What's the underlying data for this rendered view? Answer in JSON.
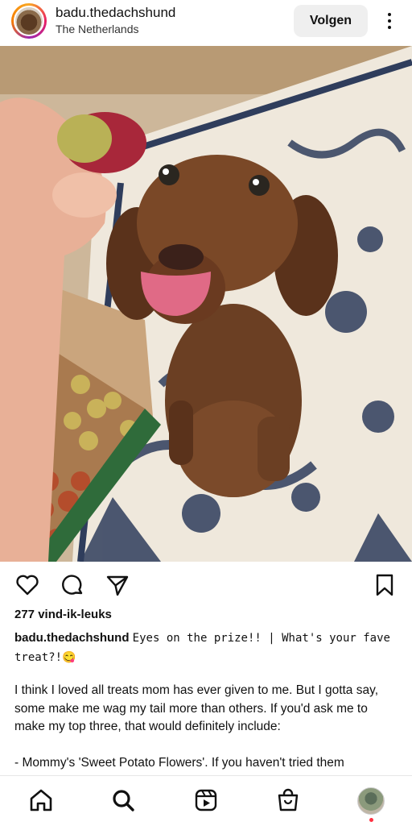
{
  "post_header": {
    "username": "badu.thedachshund",
    "location": "The Netherlands",
    "follow_label": "Volgen"
  },
  "photo": {
    "icon": "post-photo-dachshund"
  },
  "actions": {
    "like_icon": "heart-icon",
    "comment_icon": "comment-icon",
    "share_icon": "send-icon",
    "save_icon": "bookmark-icon"
  },
  "likes_text": "277 vind-ik-leuks",
  "caption": {
    "username": "badu.thedachshund",
    "text": "Eyes on the prize!! | What's your fave treat?!😋"
  },
  "body": {
    "paragraph1": "I think I loved all treats mom has ever given to me. But I gotta say, some make me wag my tail more than others. If you'd ask me to make my top three, that would definitely include:",
    "paragraph2": "- Mommy's 'Sweet Potato Flowers'. If you haven't tried them"
  },
  "bottom_nav": {
    "items": [
      "home-icon",
      "search-icon",
      "reels-icon",
      "shop-icon",
      "profile-avatar"
    ],
    "notification_color": "#ff3040"
  }
}
